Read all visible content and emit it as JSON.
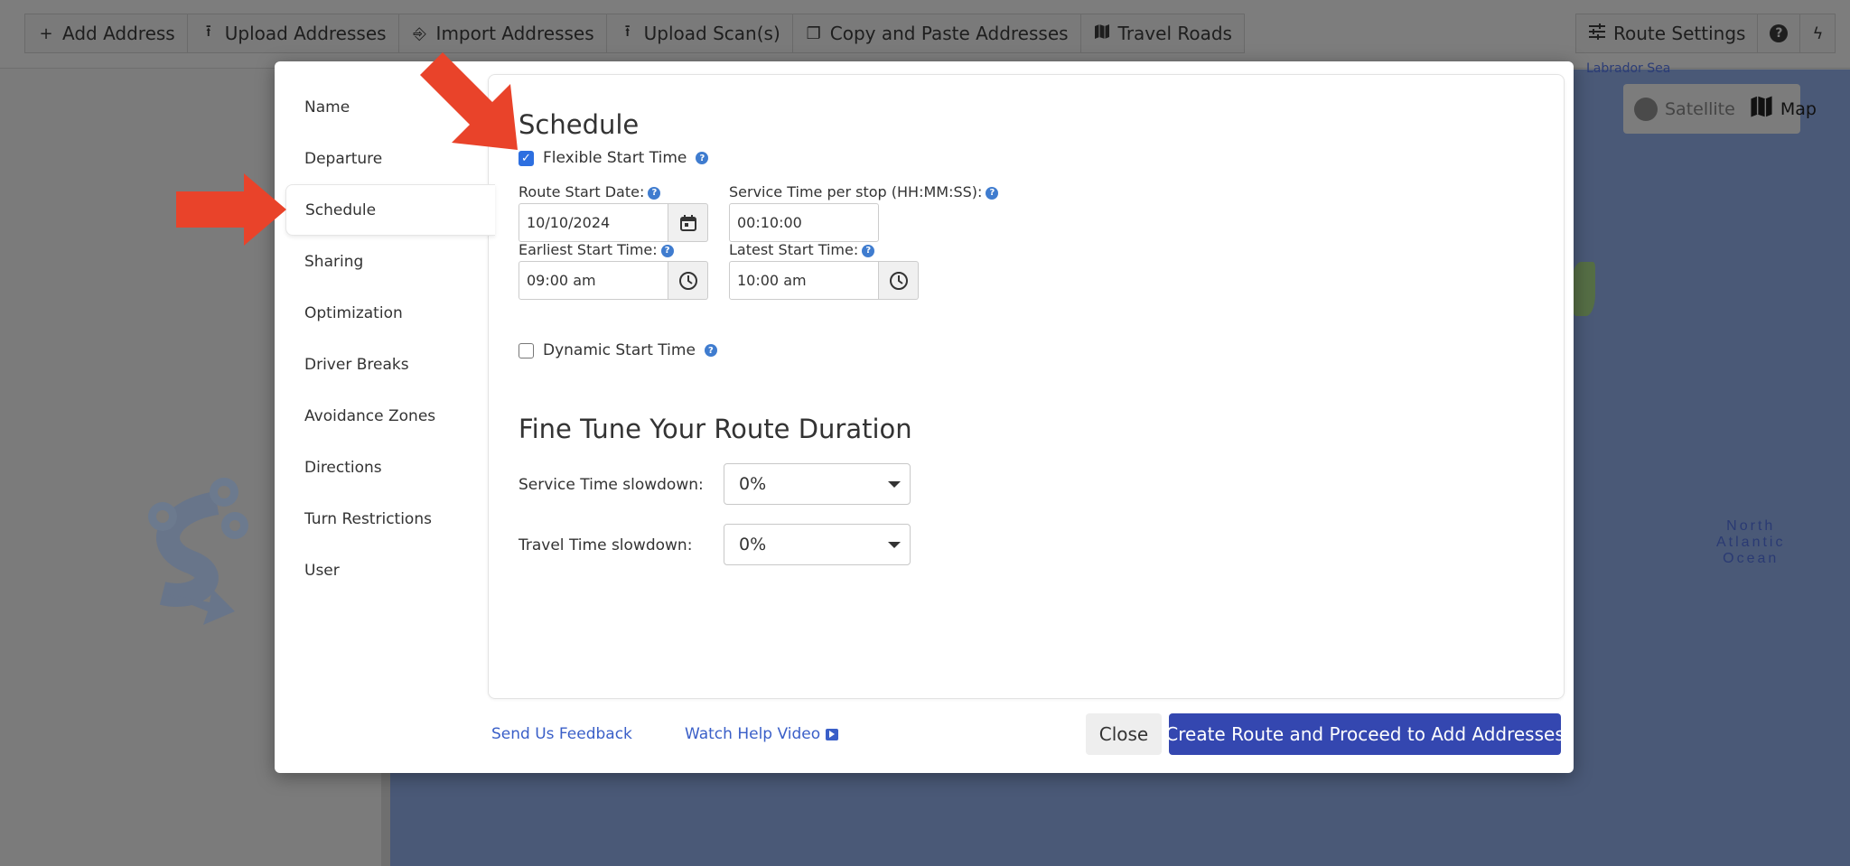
{
  "toolbar": {
    "left_buttons": [
      {
        "label": "Add Address",
        "icon": "plus-icon"
      },
      {
        "label": "Upload Addresses",
        "icon": "upload-icon"
      },
      {
        "label": "Import Addresses",
        "icon": "import-icon"
      },
      {
        "label": "Upload Scan(s)",
        "icon": "upload-icon"
      },
      {
        "label": "Copy and Paste Addresses",
        "icon": "copy-icon"
      },
      {
        "label": "Travel Roads",
        "icon": "map-icon"
      }
    ],
    "right_buttons": [
      {
        "label": "Route Settings",
        "icon": "sliders-icon"
      },
      {
        "label": "",
        "icon": "help-circle-icon"
      },
      {
        "label": "",
        "icon": "bolt-icon"
      }
    ]
  },
  "map": {
    "top_label": "Labrador Sea",
    "ocean_label_lines": [
      "North",
      "Atlantic",
      "Ocean"
    ],
    "type_toggle": {
      "satellite": "Satellite",
      "map": "Map",
      "selected": "Map"
    }
  },
  "modal": {
    "nav": [
      {
        "label": "Name",
        "active": false
      },
      {
        "label": "Departure",
        "active": false
      },
      {
        "label": "Schedule",
        "active": true
      },
      {
        "label": "Sharing",
        "active": false
      },
      {
        "label": "Optimization",
        "active": false
      },
      {
        "label": "Driver Breaks",
        "active": false
      },
      {
        "label": "Avoidance Zones",
        "active": false
      },
      {
        "label": "Directions",
        "active": false
      },
      {
        "label": "Turn Restrictions",
        "active": false
      },
      {
        "label": "User",
        "active": false
      }
    ],
    "schedule": {
      "title": "Schedule",
      "flexible_start_time": {
        "label": "Flexible Start Time",
        "checked": true
      },
      "route_start_date": {
        "label": "Route Start Date:",
        "value": "10/10/2024"
      },
      "service_time_per_stop": {
        "label": "Service Time per stop (HH:MM:SS):",
        "value": "00:10:00"
      },
      "earliest_start_time": {
        "label": "Earliest Start Time:",
        "value": "09:00 am"
      },
      "latest_start_time": {
        "label": "Latest Start Time:",
        "value": "10:00 am"
      },
      "dynamic_start_time": {
        "label": "Dynamic Start Time",
        "checked": false
      }
    },
    "fine_tune": {
      "title": "Fine Tune Your Route Duration",
      "service_time_slowdown": {
        "label": "Service Time slowdown:",
        "value": "0%"
      },
      "travel_time_slowdown": {
        "label": "Travel Time slowdown:",
        "value": "0%"
      }
    },
    "footer": {
      "feedback_link": "Send Us Feedback",
      "help_video_link": "Watch Help Video",
      "close_button": "Close",
      "primary_button": "Create Route and Proceed to Add Addresses"
    }
  },
  "annotations": {
    "arrow_color": "#e9432a"
  }
}
